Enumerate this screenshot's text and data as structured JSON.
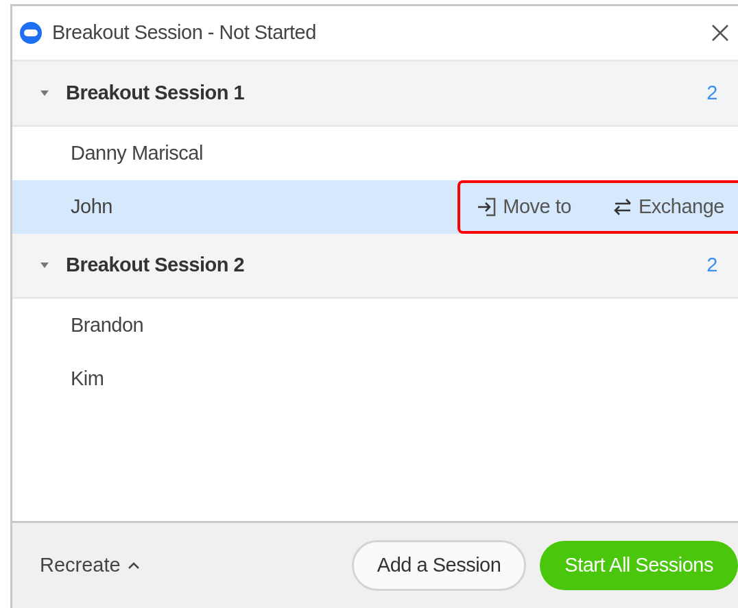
{
  "window": {
    "title": "Breakout Session - Not Started"
  },
  "sessions": [
    {
      "name": "Breakout Session 1",
      "count": "2",
      "expanded": true,
      "participants": [
        {
          "name": "Danny Mariscal",
          "selected": false
        },
        {
          "name": "John",
          "selected": true,
          "actions_highlighted": true,
          "actions": [
            {
              "label": "Move to",
              "kind": "move"
            },
            {
              "label": "Exchange",
              "kind": "exchange"
            }
          ]
        }
      ]
    },
    {
      "name": "Breakout Session 2",
      "count": "2",
      "expanded": true,
      "participants": [
        {
          "name": "Brandon",
          "selected": false
        },
        {
          "name": "Kim",
          "selected": false
        }
      ]
    }
  ],
  "footer": {
    "menu": "Recreate",
    "buttons": [
      {
        "label": "Add a Session",
        "kind": "secondary"
      },
      {
        "label": "Start All Sessions",
        "kind": "primary"
      }
    ]
  }
}
